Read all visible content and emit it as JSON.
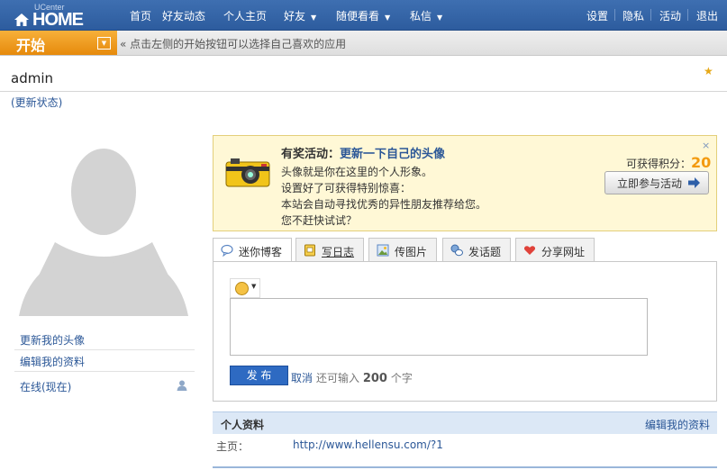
{
  "logo": {
    "small": "UCenter",
    "big": "HOME"
  },
  "nav": {
    "items": [
      {
        "label": "首页",
        "dropdown": false
      },
      {
        "label": "好友动态",
        "dropdown": false
      },
      {
        "label": "个人主页",
        "dropdown": false
      },
      {
        "label": "好友",
        "dropdown": true
      },
      {
        "label": "随便看看",
        "dropdown": true
      },
      {
        "label": "私信",
        "dropdown": true
      }
    ],
    "right": [
      "设置",
      "隐私",
      "活动",
      "退出"
    ]
  },
  "startbar": {
    "start_label": "开始",
    "hint": "« 点击左侧的开始按钮可以选择自己喜欢的应用"
  },
  "user": {
    "name": "admin",
    "update_status": "(更新状态)"
  },
  "sidebar": {
    "links": [
      "更新我的头像",
      "编辑我的资料",
      "在线(现在)"
    ]
  },
  "activity": {
    "title_prefix": "有奖活动：",
    "title_highlight": "更新一下自己的头像",
    "lines": [
      "头像就是你在这里的个人形象。",
      "设置好了可获得特别惊喜：",
      "本站会自动寻找优秀的异性朋友推荐给您。",
      "您不赶快试试？"
    ],
    "points_label": "可获得积分：",
    "points_value": "20",
    "join_label": "立即参与活动",
    "close": "×"
  },
  "tabs": [
    {
      "label": "迷你博客",
      "icon": "chat-bubble-icon",
      "active": true
    },
    {
      "label": "写日志",
      "icon": "notebook-icon",
      "active": false
    },
    {
      "label": "传图片",
      "icon": "picture-icon",
      "active": false
    },
    {
      "label": "发话题",
      "icon": "topic-icon",
      "active": false
    },
    {
      "label": "分享网址",
      "icon": "heart-share-icon",
      "active": false
    }
  ],
  "compose": {
    "publish_label": "发 布",
    "cancel_label": "取消",
    "remain_prefix": "还可输入",
    "remain_count": "200",
    "remain_suffix": "个字"
  },
  "profile": {
    "title": "个人资料",
    "edit_label": "编辑我的资料",
    "homepage_label": "主页：",
    "homepage_url": "http://www.hellensu.com/?1"
  },
  "colors": {
    "topbar": "#2d5c9e",
    "start": "#f39a0f",
    "link": "#2b5797",
    "activity_bg": "#fff8d6"
  }
}
